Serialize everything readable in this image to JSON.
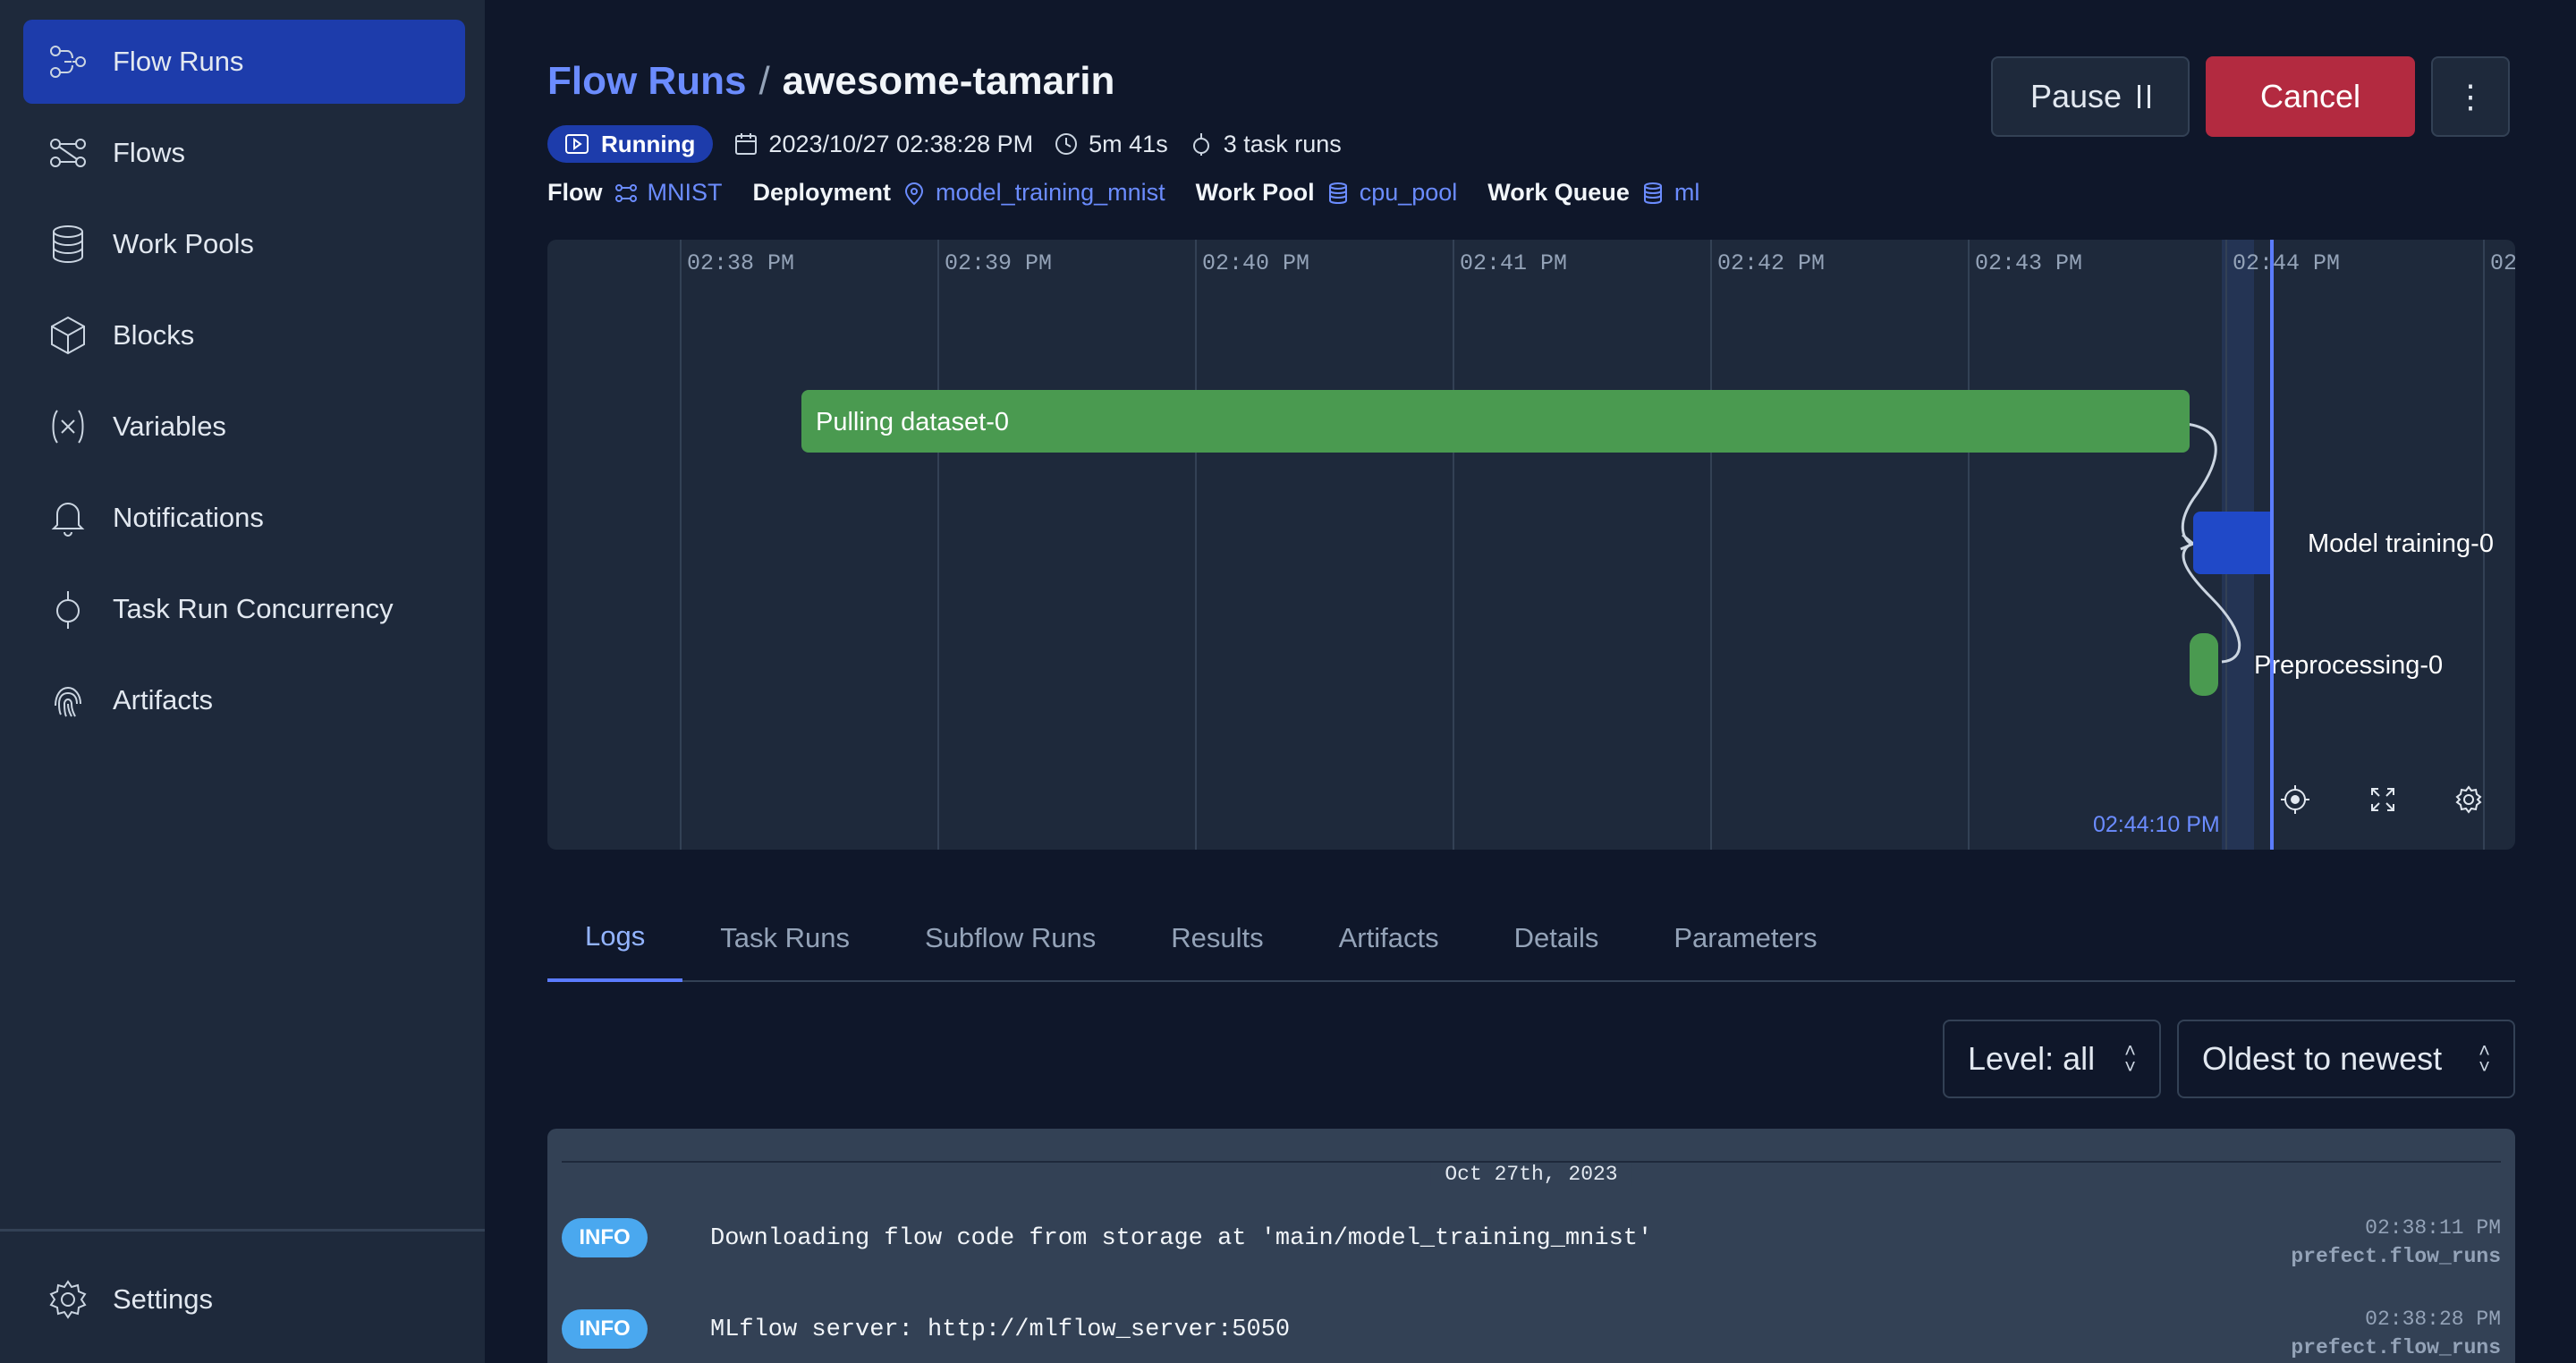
{
  "sidebar": {
    "items": [
      {
        "label": "Flow Runs",
        "icon": "flow-runs-icon",
        "active": true
      },
      {
        "label": "Flows",
        "icon": "flows-icon"
      },
      {
        "label": "Work Pools",
        "icon": "database-icon"
      },
      {
        "label": "Blocks",
        "icon": "cube-icon"
      },
      {
        "label": "Variables",
        "icon": "variable-icon"
      },
      {
        "label": "Notifications",
        "icon": "bell-icon"
      },
      {
        "label": "Task Run Concurrency",
        "icon": "concurrency-icon"
      },
      {
        "label": "Artifacts",
        "icon": "fingerprint-icon"
      }
    ],
    "settings": {
      "label": "Settings",
      "icon": "gear-icon"
    }
  },
  "header": {
    "crumb_link": "Flow Runs",
    "crumb_sep": "/",
    "run_name": "awesome-tamarin",
    "pause_label": "Pause",
    "cancel_label": "Cancel",
    "more_label": "⋮"
  },
  "meta": {
    "state": "Running",
    "start_time": "2023/10/27 02:38:28 PM",
    "duration": "5m 41s",
    "task_runs": "3 task runs"
  },
  "meta2": {
    "flow_label": "Flow",
    "flow_value": "MNIST",
    "deployment_label": "Deployment",
    "deployment_value": "model_training_mnist",
    "work_pool_label": "Work Pool",
    "work_pool_value": "cpu_pool",
    "work_queue_label": "Work Queue",
    "work_queue_value": "ml"
  },
  "timeline": {
    "ticks": [
      "02:38 PM",
      "02:39 PM",
      "02:40 PM",
      "02:41 PM",
      "02:42 PM",
      "02:43 PM",
      "02:44 PM",
      "02"
    ],
    "now_label": "02:44:10 PM",
    "tasks": [
      {
        "label": "Pulling dataset-0",
        "color": "#4a9a50"
      },
      {
        "label": "Model training-0",
        "color": "#2049c8"
      },
      {
        "label": "Preprocessing-0",
        "color": "#4a9a50"
      }
    ]
  },
  "tabs": [
    "Logs",
    "Task Runs",
    "Subflow Runs",
    "Results",
    "Artifacts",
    "Details",
    "Parameters"
  ],
  "filters": {
    "level": "Level: all",
    "order": "Oldest to newest"
  },
  "logs": {
    "date": "Oct 27th, 2023",
    "entries": [
      {
        "level": "INFO",
        "message": "Downloading flow code from storage at 'main/model_training_mnist'",
        "time": "02:38:11 PM",
        "source": "prefect.flow_runs"
      },
      {
        "level": "INFO",
        "message": "MLflow server: http://mlflow_server:5050",
        "time": "02:38:28 PM",
        "source": "prefect.flow_runs"
      }
    ]
  },
  "colors": {
    "accent": "#1d3cab",
    "link": "#6b8cff",
    "cancel": "#b32a40",
    "completed": "#4a9a50",
    "running": "#2049c8",
    "info": "#4aa8ef"
  }
}
